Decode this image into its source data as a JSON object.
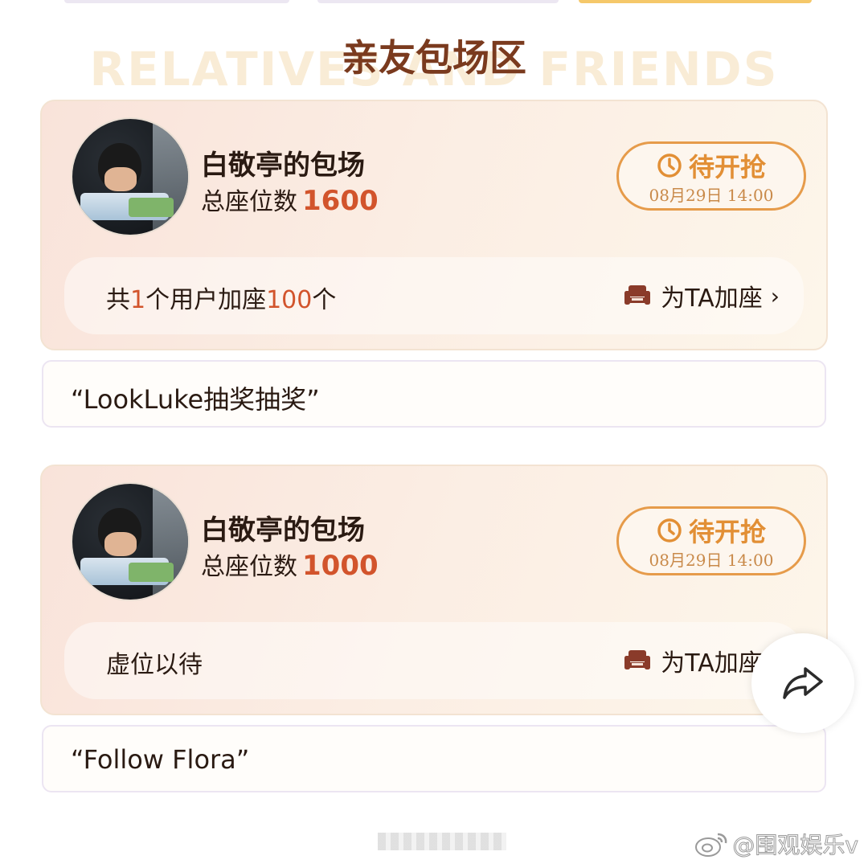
{
  "section": {
    "title": "亲友包场区",
    "bg_text": "RELATIVES AND FRIENDS"
  },
  "cards": [
    {
      "title": "白敬亭的包场",
      "seats_label": "总座位数",
      "seats_total": "1600",
      "status": "待开抢",
      "time": "08月29日 14:00",
      "row_prefix": "共",
      "row_users": "1",
      "row_mid": "个用户加座",
      "row_seats": "100",
      "row_suffix": "个",
      "add_seat_label": "为TA加座",
      "message": "“LookLuke抽奖抽奖”"
    },
    {
      "title": "白敬亭的包场",
      "seats_label": "总座位数",
      "seats_total": "1000",
      "status": "待开抢",
      "time": "08月29日 14:00",
      "row_text": "虚位以待",
      "add_seat_label": "为TA加座",
      "message": "“Follow Flora”"
    }
  ],
  "watermark": "@围观娱乐v",
  "icons": {
    "clock": "clock-icon",
    "seat": "sofa-icon",
    "share": "share-arrow-icon",
    "chevron": "chevron-right-icon"
  },
  "colors": {
    "accent_orange": "#e28f35",
    "number_red": "#d2542c",
    "title_brown": "#7a3a1e",
    "seat_icon": "#8a3b2a"
  }
}
